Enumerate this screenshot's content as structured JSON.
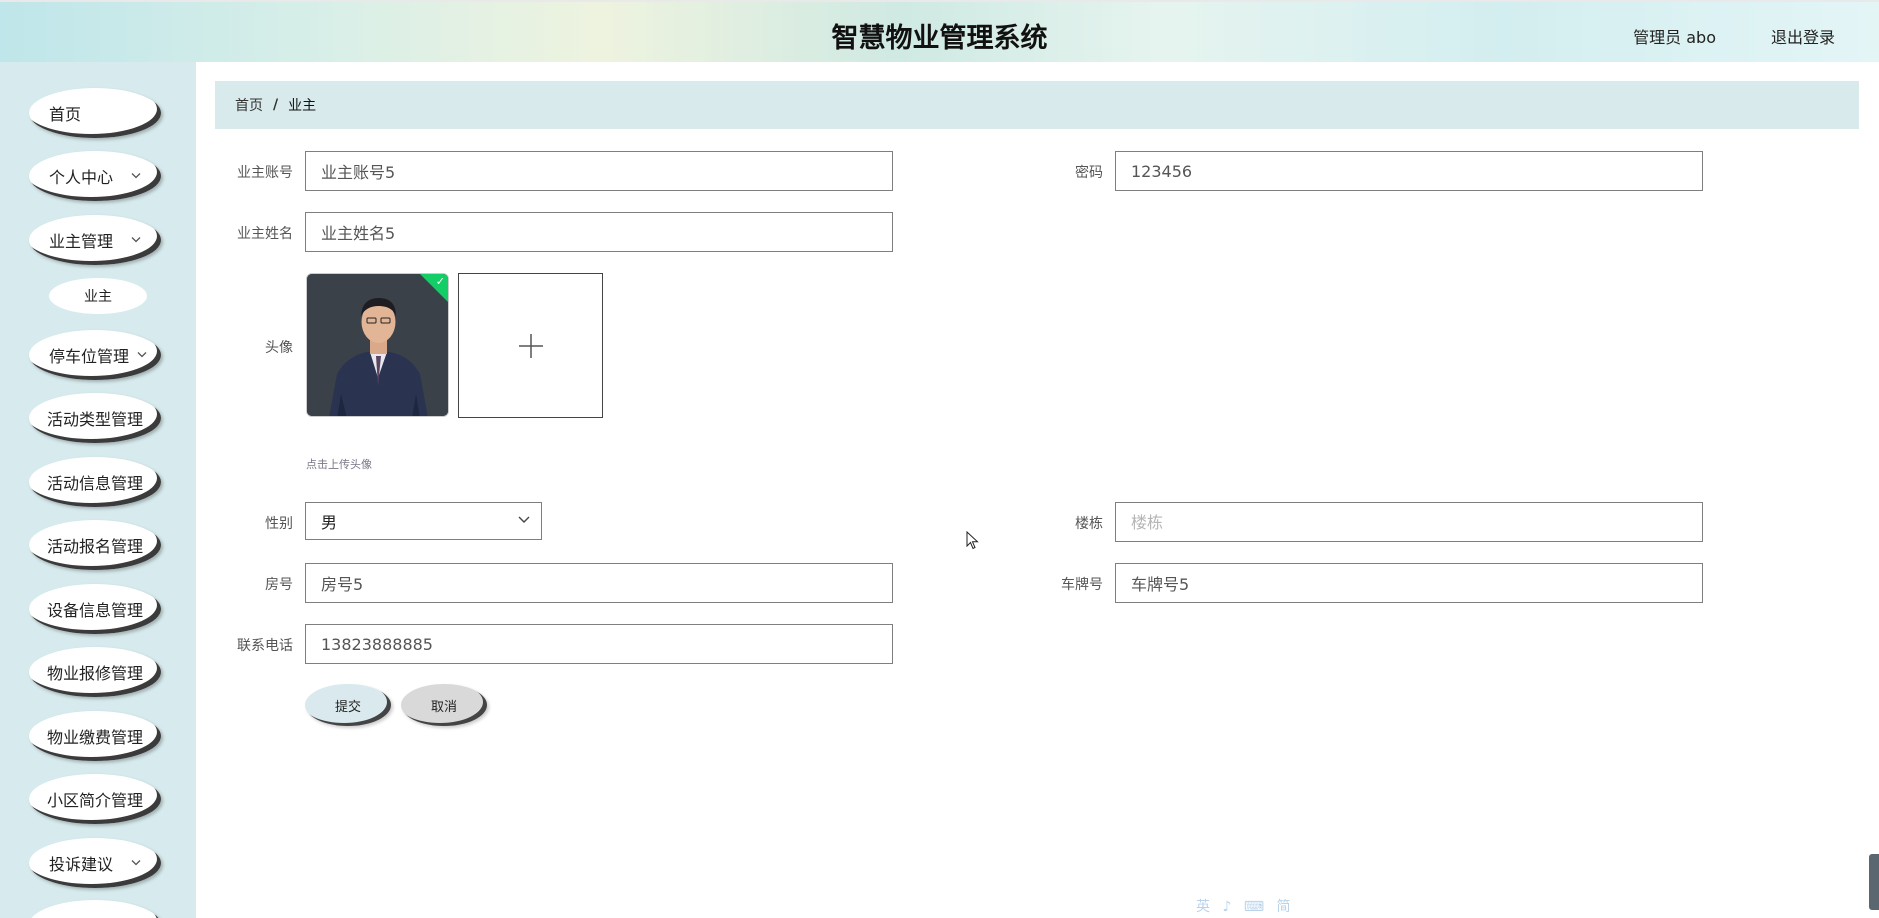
{
  "header": {
    "title": "智慧物业管理系统",
    "user": "管理员 abo",
    "logout": "退出登录"
  },
  "sidebar": {
    "items": [
      {
        "label": "首页"
      },
      {
        "label": "个人中心"
      },
      {
        "label": "业主管理"
      },
      {
        "label": "业主"
      },
      {
        "label": "停车位管理"
      },
      {
        "label": "活动类型管理"
      },
      {
        "label": "活动信息管理"
      },
      {
        "label": "活动报名管理"
      },
      {
        "label": "设备信息管理"
      },
      {
        "label": "物业报修管理"
      },
      {
        "label": "物业缴费管理"
      },
      {
        "label": "小区简介管理"
      },
      {
        "label": "投诉建议"
      }
    ]
  },
  "breadcrumb": {
    "home": "首页",
    "separator": "/",
    "current": "业主"
  },
  "form": {
    "account": {
      "label": "业主账号",
      "value": "业主账号5"
    },
    "password": {
      "label": "密码",
      "value": "123456"
    },
    "name": {
      "label": "业主姓名",
      "value": "业主姓名5"
    },
    "avatar": {
      "label": "头像",
      "hint": "点击上传头像"
    },
    "gender": {
      "label": "性别",
      "value": "男"
    },
    "building": {
      "label": "楼栋",
      "placeholder": "楼栋"
    },
    "room": {
      "label": "房号",
      "value": "房号5"
    },
    "plate": {
      "label": "车牌号",
      "value": "车牌号5"
    },
    "phone": {
      "label": "联系电话",
      "value": "13823888885"
    },
    "submit": "提交",
    "cancel": "取消"
  },
  "ime": "英 ♪ ⌨ 简"
}
